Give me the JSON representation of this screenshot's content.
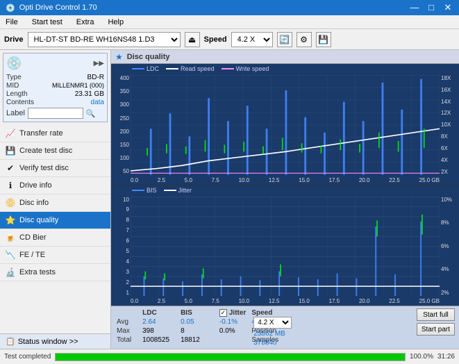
{
  "app": {
    "title": "Opti Drive Control 1.70",
    "icon": "💿"
  },
  "title_buttons": {
    "minimize": "—",
    "maximize": "□",
    "close": "✕"
  },
  "menu": {
    "items": [
      "File",
      "Start test",
      "Extra",
      "Help"
    ]
  },
  "toolbar": {
    "drive_label": "Drive",
    "drive_value": "(G:)  HL-DT-ST BD-RE  WH16NS48 1.D3",
    "speed_label": "Speed",
    "speed_value": "4.2 X"
  },
  "disc_panel": {
    "type_label": "Type",
    "type_value": "BD-R",
    "mid_label": "MID",
    "mid_value": "MILLENMR1 (000)",
    "length_label": "Length",
    "length_value": "23.31 GB",
    "contents_label": "Contents",
    "contents_value": "data",
    "label_label": "Label",
    "label_placeholder": ""
  },
  "nav": {
    "items": [
      {
        "id": "transfer-rate",
        "label": "Transfer rate",
        "icon": "📈"
      },
      {
        "id": "create-test-disc",
        "label": "Create test disc",
        "icon": "💾"
      },
      {
        "id": "verify-test-disc",
        "label": "Verify test disc",
        "icon": "✔"
      },
      {
        "id": "drive-info",
        "label": "Drive info",
        "icon": "ℹ"
      },
      {
        "id": "disc-info",
        "label": "Disc info",
        "icon": "📀"
      },
      {
        "id": "disc-quality",
        "label": "Disc quality",
        "icon": "⭐",
        "active": true
      },
      {
        "id": "cd-bier",
        "label": "CD Bier",
        "icon": "🍺"
      },
      {
        "id": "fe-te",
        "label": "FE / TE",
        "icon": "📉"
      },
      {
        "id": "extra-tests",
        "label": "Extra tests",
        "icon": "🔬"
      }
    ]
  },
  "status_window": {
    "label": "Status window >>",
    "icon": "📋"
  },
  "progress": {
    "percent": 100,
    "text": "100.0%",
    "time": "31:26",
    "status": "Test completed"
  },
  "disc_quality": {
    "title": "Disc quality",
    "icon": "★",
    "legend_upper": [
      {
        "label": "LDC",
        "color": "#0080ff"
      },
      {
        "label": "Read speed",
        "color": "#ffffff"
      },
      {
        "label": "Write speed",
        "color": "#ff00ff"
      }
    ],
    "legend_lower": [
      {
        "label": "BIS",
        "color": "#0080ff"
      },
      {
        "label": "Jitter",
        "color": "#ffffff"
      }
    ],
    "upper_y_left": [
      "400",
      "350",
      "300",
      "250",
      "200",
      "150",
      "100",
      "50"
    ],
    "upper_y_right": [
      "18X",
      "16X",
      "14X",
      "12X",
      "10X",
      "8X",
      "6X",
      "4X",
      "2X"
    ],
    "lower_y_left": [
      "10",
      "9",
      "8",
      "7",
      "6",
      "5",
      "4",
      "3",
      "2",
      "1"
    ],
    "lower_y_right": [
      "10%",
      "8%",
      "6%",
      "4%",
      "2%"
    ],
    "x_labels": [
      "0.0",
      "2.5",
      "5.0",
      "7.5",
      "10.0",
      "12.5",
      "15.0",
      "17.5",
      "20.0",
      "22.5",
      "25.0 GB"
    ]
  },
  "stats": {
    "col_headers": [
      "",
      "LDC",
      "BIS",
      "",
      "Jitter",
      "Speed"
    ],
    "avg_label": "Avg",
    "avg_ldc": "2.64",
    "avg_bis": "0.05",
    "avg_jitter": "-0.1%",
    "max_label": "Max",
    "max_ldc": "398",
    "max_bis": "8",
    "max_jitter": "0.0%",
    "total_label": "Total",
    "total_ldc": "1008525",
    "total_bis": "18812",
    "speed_label": "Speed",
    "speed_value": "4.23 X",
    "speed_select": "4.2 X",
    "position_label": "Position",
    "position_value": "23862 MB",
    "samples_label": "Samples",
    "samples_value": "378840",
    "jitter_checkbox": true,
    "btn_start_full": "Start full",
    "btn_start_part": "Start part"
  }
}
